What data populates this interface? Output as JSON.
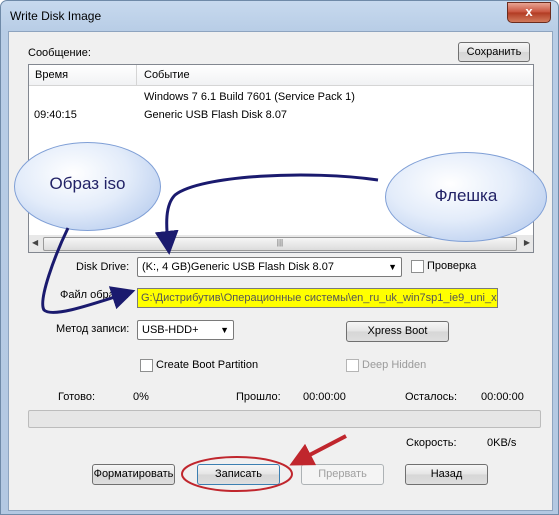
{
  "window": {
    "title": "Write Disk Image",
    "close": "x"
  },
  "log": {
    "label": "Сообщение:",
    "save_button": "Сохранить",
    "columns": [
      "Время",
      "Событие"
    ],
    "rows": [
      {
        "time": "",
        "event": "Windows 7 6.1 Build 7601 (Service Pack 1)"
      },
      {
        "time": "09:40:15",
        "event": "Generic USB Flash Disk  8.07"
      }
    ]
  },
  "annotations": {
    "iso_bubble": "Образ iso",
    "flash_bubble": "Флешка"
  },
  "form": {
    "disk_drive_label": "Disk Drive:",
    "disk_drive_value": "(K:, 4 GB)Generic USB Flash Disk  8.07",
    "verify_label": "Проверка",
    "image_file_label": "Файл образа:",
    "image_file_value": "G:\\Дистрибутив\\Операционные системы\\en_ru_uk_win7sp1_ie9_uni_x",
    "write_method_label": "Метод записи:",
    "write_method_value": "USB-HDD+",
    "xpress_boot": "Xpress Boot",
    "create_boot_partition": "Create Boot Partition",
    "deep_hidden": "Deep Hidden"
  },
  "status": {
    "done_label": "Готово:",
    "done_value": "0%",
    "elapsed_label": "Прошло:",
    "elapsed_value": "00:00:00",
    "remaining_label": "Осталось:",
    "remaining_value": "00:00:00",
    "speed_label": "Скорость:",
    "speed_value": "0KB/s",
    "progress": 0
  },
  "buttons": {
    "format": "Форматировать",
    "write": "Записать",
    "abort": "Прервать",
    "back": "Назад"
  },
  "colors": {
    "highlight_yellow": "#ffff00",
    "annotation_red": "#c0262d",
    "arrow_navy": "#1a1a6e"
  }
}
